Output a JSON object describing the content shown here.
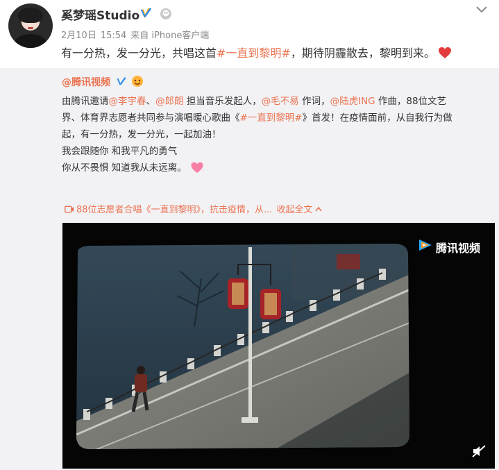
{
  "post": {
    "username": "奚梦瑶Studio",
    "date": "2月10日",
    "time": "15:54",
    "source": "来自 iPhone客户端",
    "text_before": "有一分热，发一分光，共唱这首",
    "hashtag": "#一直到黎明#",
    "text_after": "，期待阴霾散去，黎明到来。",
    "accent_color": "#eb7350",
    "icons": [
      "verified-icon",
      "member-icon",
      "chevron-down-icon",
      "heart-icon"
    ]
  },
  "repost": {
    "author": "@腾讯视频",
    "line1": {
      "t1": "由腾讯邀请",
      "m1": "@李宇春",
      "t2": "、",
      "m2": "@郎朗",
      "t3": " 担当音乐发起人，",
      "m3": "@毛不易",
      "t4": " 作词，",
      "m4": "@陆虎ING",
      "t5": " 作曲，88位文艺"
    },
    "line2": {
      "t1": "界、体育界志愿者共同参与演唱暖心歌曲《",
      "hashtag": "#一直到黎明#",
      "t2": "》首发！在疫情面前，从自我行为做"
    },
    "line3": "起，有一分热，发一分光，一起加油！",
    "line4": "我会跟随你 和我平凡的勇气",
    "line5": "你从不畏惧 知道我从未远离。",
    "video_title": "88位志愿者合唱《一直到黎明》，抗击疫情，从...",
    "collapse_label": "收起全文",
    "video": {
      "brand": "腾讯视频"
    }
  }
}
